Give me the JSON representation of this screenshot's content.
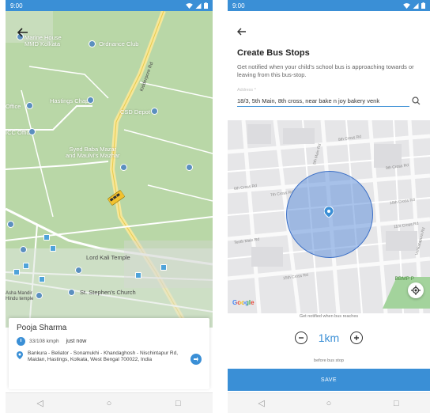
{
  "left": {
    "status_time": "9:00",
    "map_labels": {
      "marine_house": "Marine House\nMMD Kolkata",
      "ordnance_club": "Ordnance Club",
      "hastings_chapel": "Hastings Chapel",
      "office": "Office",
      "csd_depot": "CSD Depot",
      "icc_office": "ICC Office",
      "syed_baba": "Syed Baba Mazar\nand Maulvi's Mazhar",
      "road_kidderpore": "Kidderpore Rd",
      "kali_temple": "Lord Kali Temple",
      "st_stephens": "St. Stephen's Church",
      "asha_mandir": "Asha Mandir\nHindu temple"
    },
    "card": {
      "name": "Pooja Sharma",
      "speed": "33/108 kmph",
      "time": "just now",
      "address": "Bankura - Beliator - Sonamukhi - Khandaghosh - Nischintapur Rd, Maidan, Hastings, Kolkata, West Bengal 700022, India"
    }
  },
  "right": {
    "status_time": "9:00",
    "title": "Create Bus Stops",
    "description": "Get notified when your child's school bus is approaching towards or leaving from this bus-stop.",
    "address_label": "Address *",
    "address_value": "18/3, 5th Main, 8th cross, near bake n joy bakery venk",
    "map_labels": {
      "road_1": "8th Cross Rd",
      "road_2": "9th Cross Rd",
      "road_3": "6th Cross Rd",
      "road_4": "7th Cross Rd",
      "road_5": "10th Cross Rd",
      "road_6": "11th Cross Rd",
      "road_7": "5th Main Rd",
      "road_8": "Tenth Main Rd",
      "road_9": "Venkatapura Rd",
      "road_10": "15th Cross Rd",
      "bbmp": "BBMP P",
      "google": "Google"
    },
    "notify_label": "Get notified when bus reaches",
    "distance": "1km",
    "before_label": "before bus stop",
    "save_label": "SAVE"
  }
}
